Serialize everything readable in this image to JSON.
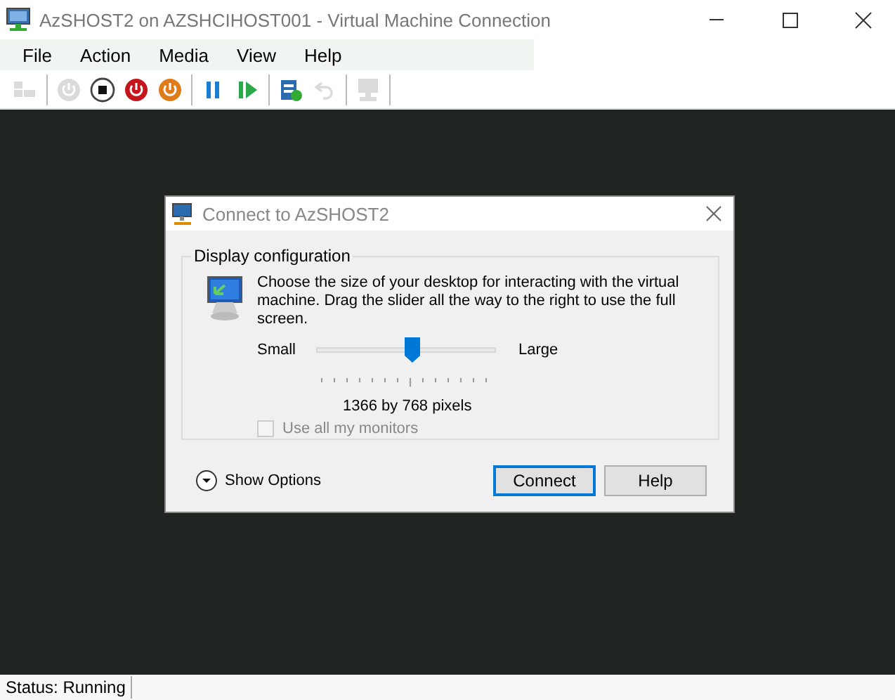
{
  "window": {
    "title": "AzSHOST2 on AZSHCIHOST001 - Virtual Machine Connection"
  },
  "menu": [
    "File",
    "Action",
    "Media",
    "View",
    "Help"
  ],
  "toolbar": {
    "groups": [
      [
        {
          "kind": "ctrl-alt-del",
          "disabled": true
        }
      ],
      [
        {
          "kind": "start",
          "disabled": true
        },
        {
          "kind": "turn-off",
          "disabled": false
        },
        {
          "kind": "shut-down",
          "disabled": false
        },
        {
          "kind": "save",
          "disabled": false
        }
      ],
      [
        {
          "kind": "pause",
          "disabled": false
        },
        {
          "kind": "reset",
          "disabled": false
        }
      ],
      [
        {
          "kind": "checkpoint",
          "disabled": false
        },
        {
          "kind": "revert",
          "disabled": true
        }
      ],
      [
        {
          "kind": "enhanced",
          "disabled": true
        }
      ]
    ]
  },
  "dialog": {
    "title": "Connect to AzSHOST2",
    "group_title": "Display configuration",
    "description": "Choose the size of your desktop for interacting with the virtual machine. Drag the slider all the way to the right to use the full screen.",
    "slider": {
      "min_label": "Small",
      "max_label": "Large",
      "level": 0.53,
      "reading": "1366 by 768 pixels"
    },
    "checkbox": {
      "label": "Use all my monitors",
      "checked": false,
      "disabled": true
    },
    "options": {
      "label": "Show Options",
      "expanded": false
    },
    "buttons": [
      {
        "label": "Connect",
        "selected": true
      },
      {
        "label": "Help",
        "selected": false
      }
    ]
  },
  "status_bar": {
    "text": "Status: Running"
  }
}
